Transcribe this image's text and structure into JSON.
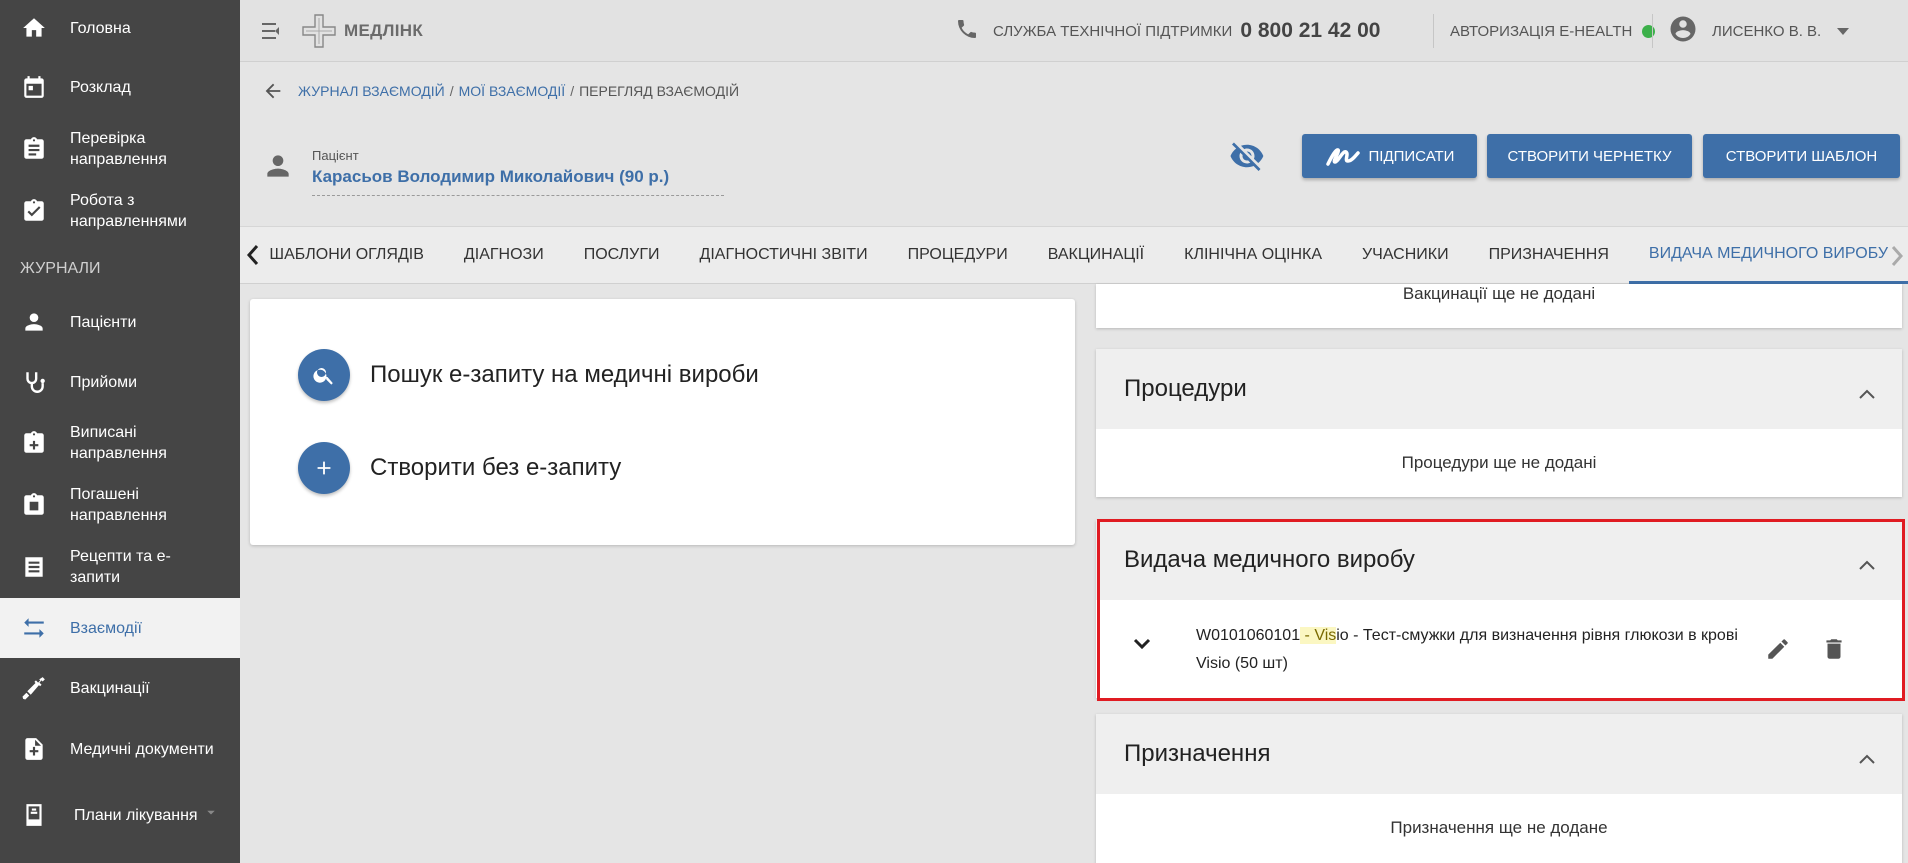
{
  "sidebar": {
    "items_top": [
      {
        "label": "Головна",
        "icon": "home-icon"
      },
      {
        "label": "Розклад",
        "icon": "calendar-icon"
      },
      {
        "label": "Перевірка направлення",
        "icon": "clipboard-search-icon"
      },
      {
        "label": "Робота з направленнями",
        "icon": "clipboard-check-icon"
      }
    ],
    "section_label": "ЖУРНАЛИ",
    "items": [
      {
        "label": "Пацієнти",
        "icon": "person-icon"
      },
      {
        "label": "Прийоми",
        "icon": "stethoscope-icon"
      },
      {
        "label": "Виписані направлення",
        "icon": "clipboard-plus-icon"
      },
      {
        "label": "Погашені направлення",
        "icon": "clipboard-done-icon"
      },
      {
        "label": "Рецепти та е-запити",
        "icon": "list-icon"
      },
      {
        "label": "Взаємодії",
        "icon": "swap-icon",
        "active": true
      },
      {
        "label": "Вакцинації",
        "icon": "syringe-icon"
      },
      {
        "label": "Медичні документи",
        "icon": "document-plus-icon"
      },
      {
        "label": "Плани лікування",
        "icon": "plan-icon"
      }
    ]
  },
  "header": {
    "logo_text": "МЕДЛІНК",
    "support_label": "СЛУЖБА ТЕХНІЧНОЇ ПІДТРИМКИ",
    "support_phone": "0 800 21 42 00",
    "auth_label": "АВТОРИЗАЦІЯ E-HEALTH",
    "auth_status_color": "#3cb04a",
    "user_name": "ЛИСЕНКО В. В."
  },
  "breadcrumb": {
    "items": [
      "ЖУРНАЛ ВЗАЄМОДІЙ",
      "МОЇ ВЗАЄМОДІЇ"
    ],
    "current": "ПЕРЕГЛЯД ВЗАЄМОДІЙ"
  },
  "patient": {
    "label": "Пацієнт",
    "name": "Карасьов Володимир Миколайович (90 р.)"
  },
  "actions": {
    "sign": "ПІДПИСАТИ",
    "draft": "СТВОРИТИ ЧЕРНЕТКУ",
    "template": "СТВОРИТИ ШАБЛОН"
  },
  "tabs": [
    "ШАБЛОНИ ОГЛЯДІВ",
    "ДІАГНОЗИ",
    "ПОСЛУГИ",
    "ДІАГНОСТИЧНІ ЗВІТИ",
    "ПРОЦЕДУРИ",
    "ВАКЦИНАЦІЇ",
    "КЛІНІЧНА ОЦІНКА",
    "УЧАСНИКИ",
    "ПРИЗНАЧЕННЯ",
    "ВИДАЧА МЕДИЧНОГО ВИРОБУ"
  ],
  "active_tab": "ВИДАЧА МЕДИЧНОГО ВИРОБУ",
  "left_card": {
    "search": "Пошук е-запиту на медичні вироби",
    "create": "Створити без е-запиту"
  },
  "panels": {
    "vaccinations_empty": "Вакцинації ще не додані",
    "procedures_title": "Процедури",
    "procedures_empty": "Процедури ще не додані",
    "device_title": "Видача медичного виробу",
    "device_item": {
      "code": "W0101060101",
      "sep1": " - ",
      "brand": "Visio",
      "rest": " - Тест-смужки для визначення рівня глюкози в крові Visio (50 шт)"
    },
    "prescriptions_title": "Призначення",
    "prescriptions_empty": "Призначення ще не додане"
  },
  "colors": {
    "accent": "#3e6fa8",
    "sidebar_bg": "#454545",
    "highlight_border": "#e01b22"
  }
}
